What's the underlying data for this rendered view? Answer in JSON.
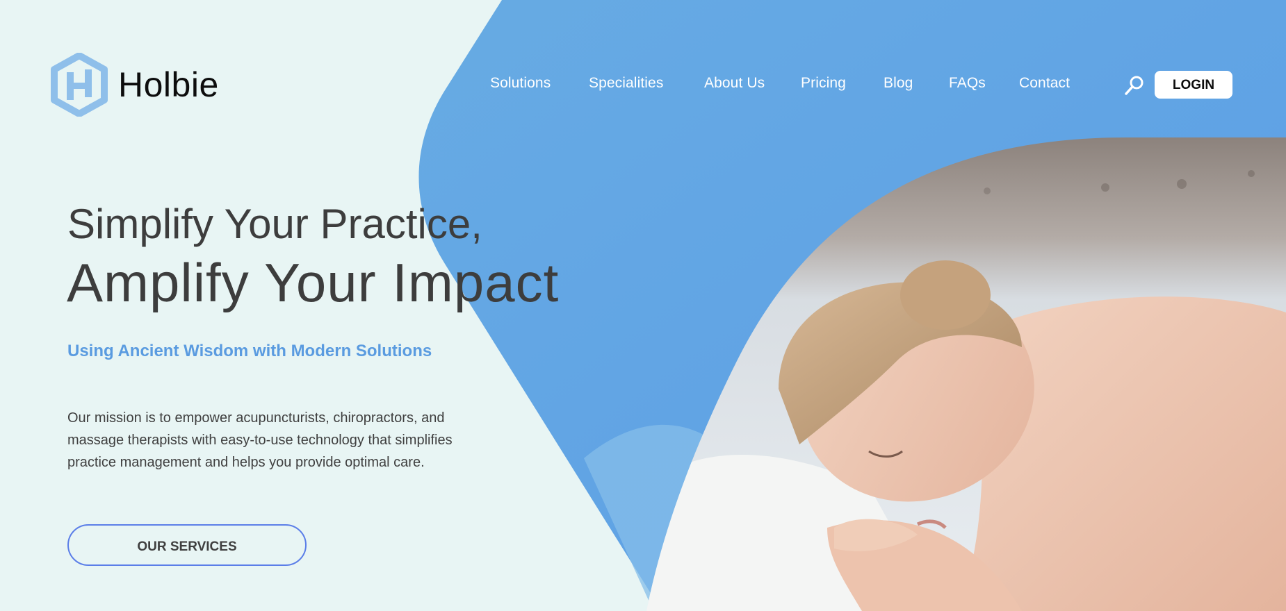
{
  "brand": {
    "name": "Holbie",
    "logo_icon": "hexagon-h-logo-icon"
  },
  "colors": {
    "page_bg": "#e8f5f4",
    "accent_blue": "#5fa4e2",
    "tagline_blue": "#5a9be0",
    "button_border": "#5b7ee8",
    "heading_text": "#3d3d3d"
  },
  "nav": {
    "items": [
      {
        "label": "Solutions"
      },
      {
        "label": "Specialities"
      },
      {
        "label": "About Us"
      },
      {
        "label": "Pricing"
      },
      {
        "label": "Blog"
      },
      {
        "label": "FAQs"
      },
      {
        "label": "Contact"
      }
    ],
    "search_icon": "search-icon",
    "login_label": "LOGIN"
  },
  "hero": {
    "title_line1": "Simplify Your Practice,",
    "title_line2": "Amplify Your Impact",
    "tagline": "Using Ancient Wisdom with Modern Solutions",
    "mission": "Our mission is to empower acupuncturists, chiropractors, and massage therapists with easy-to-use technology that simplifies practice management and helps you provide optimal care.",
    "cta_label": "OUR SERVICES"
  }
}
